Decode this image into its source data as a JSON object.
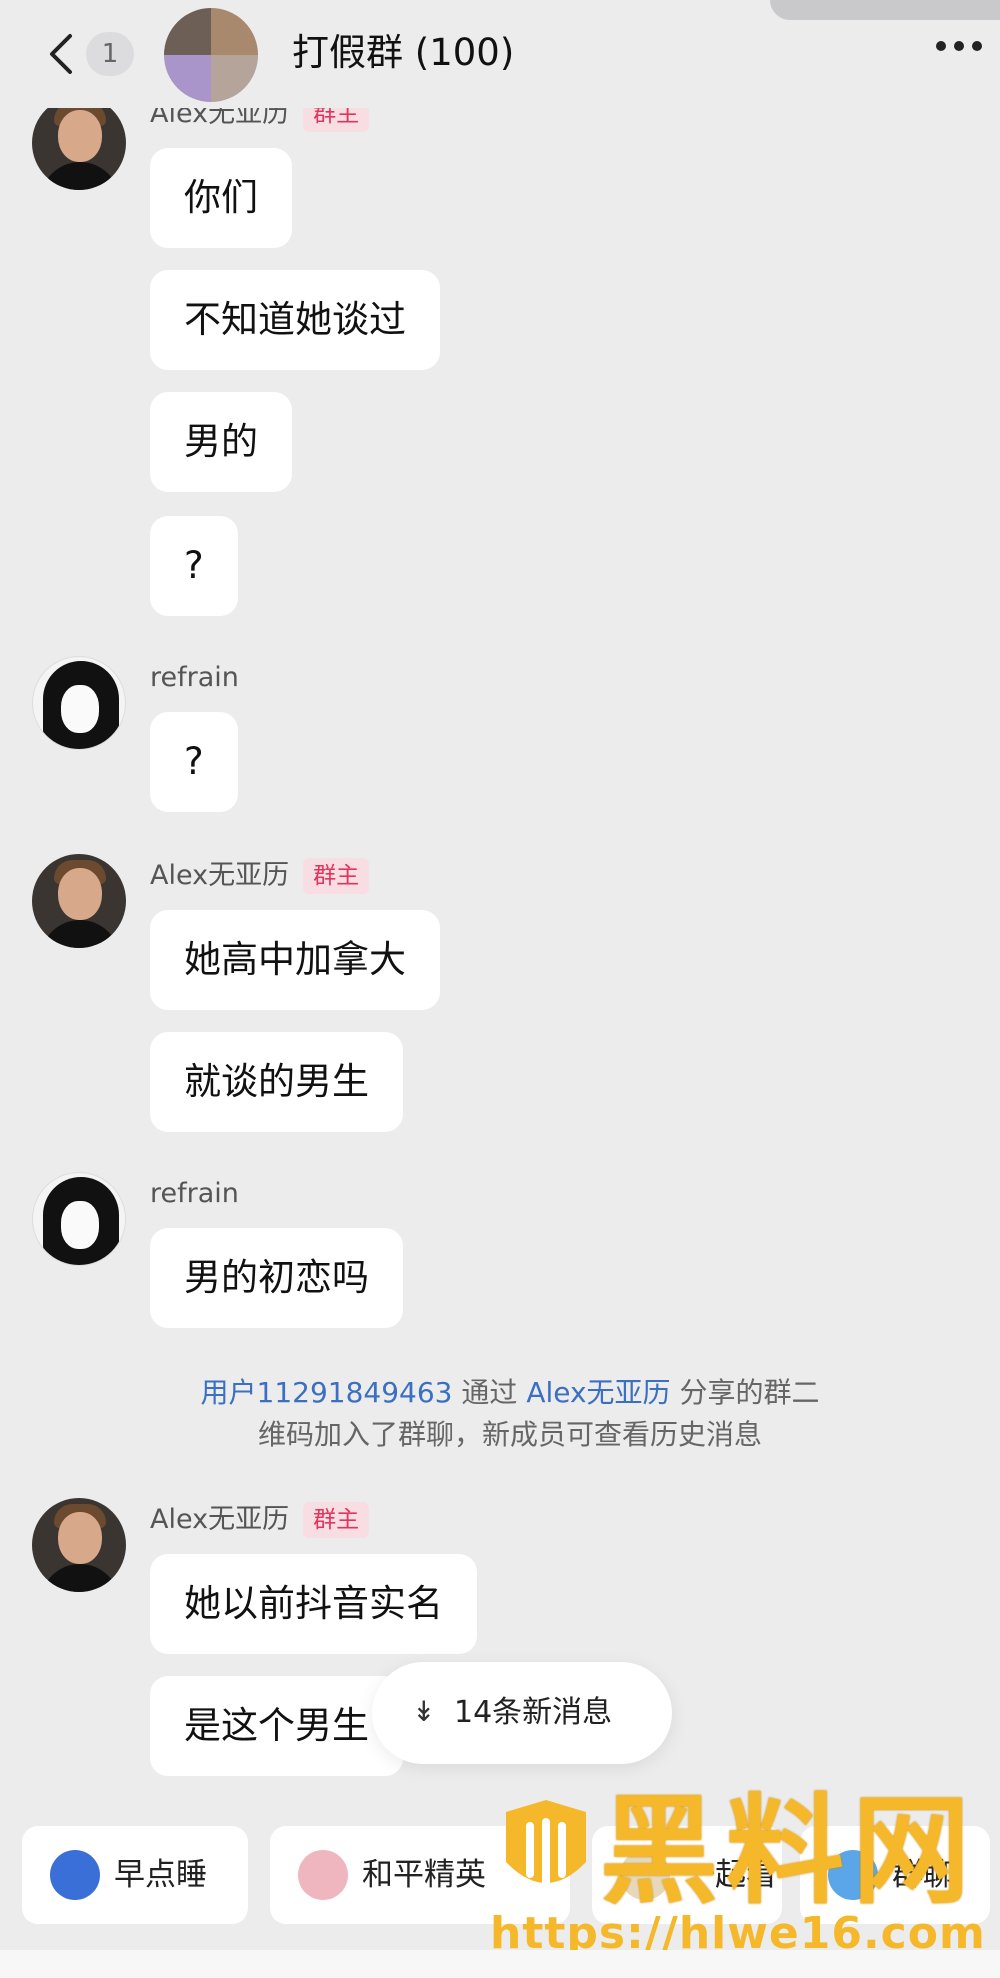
{
  "header": {
    "unread_count": "1",
    "title": "打假群 (100)"
  },
  "messages": [
    {
      "sender": "Alex无亚历",
      "badge": "群主",
      "bubbles": [
        "你们",
        "不知道她谈过",
        "男的",
        "?"
      ]
    },
    {
      "sender": "refrain",
      "bubbles": [
        "?"
      ]
    },
    {
      "sender": "Alex无亚历",
      "badge": "群主",
      "bubbles": [
        "她高中加拿大",
        "就谈的男生"
      ]
    },
    {
      "sender": "refrain",
      "bubbles": [
        "男的初恋吗"
      ]
    },
    {
      "sender": "Alex无亚历",
      "badge": "群主",
      "bubbles": [
        "她以前抖音实名",
        "是这个男生"
      ]
    }
  ],
  "system_message": {
    "user": "用户11291849463",
    "via": "通过",
    "inviter": "Alex无亚历",
    "line1_tail": "分享的群二",
    "line2": "维码加入了群聊，新成员可查看历史消息"
  },
  "new_messages_pill": "14条新消息",
  "shortcuts": [
    "早点睡",
    "和平精英",
    "一起看",
    "群聊"
  ],
  "watermark": {
    "brand": "黑料网",
    "url": "https://hlwe16.com"
  }
}
